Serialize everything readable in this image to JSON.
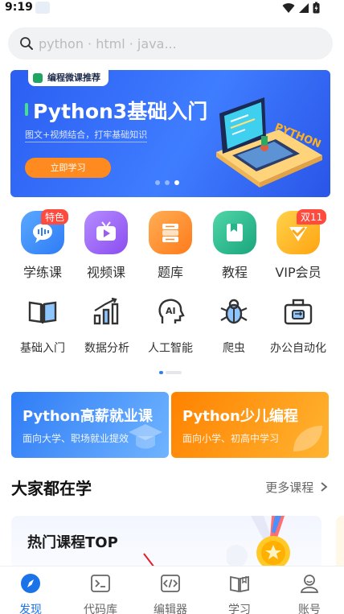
{
  "status_bar": {
    "time": "9:19"
  },
  "search": {
    "placeholder": "python · html · java..."
  },
  "banner": {
    "tag": "编程微课推荐",
    "title": "Python3基础入门",
    "subtitle": "图文+视频结合，打牢基础知识",
    "button": "立即学习",
    "art_text": "PYTHON",
    "dots": 3,
    "active_dot": 2
  },
  "quick_items": [
    {
      "label": "学练课",
      "badge": "特色",
      "icon": "chat-wave-icon",
      "color": "#3a8cf6"
    },
    {
      "label": "视频课",
      "badge": "",
      "icon": "tv-icon",
      "color": "#9b5cf0"
    },
    {
      "label": "题库",
      "badge": "",
      "icon": "book-stack-icon",
      "color": "#ff8a2b"
    },
    {
      "label": "教程",
      "badge": "",
      "icon": "tutorial-book-icon",
      "color": "#23b68a"
    },
    {
      "label": "VIP会员",
      "badge": "双11",
      "icon": "vip-icon",
      "color": "#ffb21d"
    }
  ],
  "categories": [
    {
      "label": "基础入门",
      "icon": "open-book-icon"
    },
    {
      "label": "数据分析",
      "icon": "bar-chart-icon"
    },
    {
      "label": "人工智能",
      "icon": "ai-head-icon"
    },
    {
      "label": "爬虫",
      "icon": "bug-icon"
    },
    {
      "label": "办公自动化",
      "icon": "briefcase-icon"
    }
  ],
  "promos": [
    {
      "title": "Python高薪就业课",
      "subtitle": "面向大学、职场就业提效",
      "color_from": "#2f7cf6",
      "color_to": "#5aa2ff"
    },
    {
      "title": "Python少儿编程",
      "subtitle": "面向小学、初高中学习",
      "color_from": "#ff8a00",
      "color_to": "#ffb02e"
    }
  ],
  "section": {
    "title": "大家都在学",
    "more": "更多课程"
  },
  "top_card": {
    "title": "热门课程TOP"
  },
  "tabs": [
    {
      "label": "发现",
      "icon": "compass-icon",
      "active": true
    },
    {
      "label": "代码库",
      "icon": "terminal-icon",
      "active": false
    },
    {
      "label": "编辑器",
      "icon": "code-editor-icon",
      "active": false
    },
    {
      "label": "学习",
      "icon": "book-icon",
      "active": false
    },
    {
      "label": "账号",
      "icon": "user-icon",
      "active": false
    }
  ],
  "colors": {
    "accent": "#1a73e8",
    "banner": "#2f6af5",
    "orange": "#ff8a1f",
    "badge": "#ff4b3e"
  }
}
